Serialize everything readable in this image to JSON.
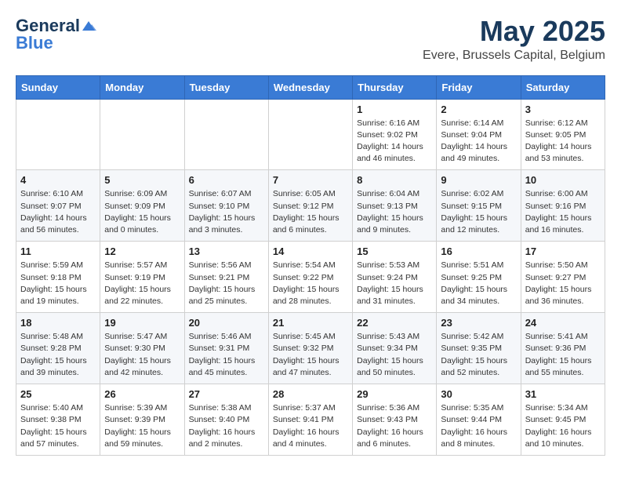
{
  "header": {
    "logo_general": "General",
    "logo_blue": "Blue",
    "month_title": "May 2025",
    "location": "Evere, Brussels Capital, Belgium"
  },
  "weekdays": [
    "Sunday",
    "Monday",
    "Tuesday",
    "Wednesday",
    "Thursday",
    "Friday",
    "Saturday"
  ],
  "weeks": [
    {
      "days": [
        {
          "number": "",
          "info": ""
        },
        {
          "number": "",
          "info": ""
        },
        {
          "number": "",
          "info": ""
        },
        {
          "number": "",
          "info": ""
        },
        {
          "number": "1",
          "info": "Sunrise: 6:16 AM\nSunset: 9:02 PM\nDaylight: 14 hours\nand 46 minutes."
        },
        {
          "number": "2",
          "info": "Sunrise: 6:14 AM\nSunset: 9:04 PM\nDaylight: 14 hours\nand 49 minutes."
        },
        {
          "number": "3",
          "info": "Sunrise: 6:12 AM\nSunset: 9:05 PM\nDaylight: 14 hours\nand 53 minutes."
        }
      ]
    },
    {
      "days": [
        {
          "number": "4",
          "info": "Sunrise: 6:10 AM\nSunset: 9:07 PM\nDaylight: 14 hours\nand 56 minutes."
        },
        {
          "number": "5",
          "info": "Sunrise: 6:09 AM\nSunset: 9:09 PM\nDaylight: 15 hours\nand 0 minutes."
        },
        {
          "number": "6",
          "info": "Sunrise: 6:07 AM\nSunset: 9:10 PM\nDaylight: 15 hours\nand 3 minutes."
        },
        {
          "number": "7",
          "info": "Sunrise: 6:05 AM\nSunset: 9:12 PM\nDaylight: 15 hours\nand 6 minutes."
        },
        {
          "number": "8",
          "info": "Sunrise: 6:04 AM\nSunset: 9:13 PM\nDaylight: 15 hours\nand 9 minutes."
        },
        {
          "number": "9",
          "info": "Sunrise: 6:02 AM\nSunset: 9:15 PM\nDaylight: 15 hours\nand 12 minutes."
        },
        {
          "number": "10",
          "info": "Sunrise: 6:00 AM\nSunset: 9:16 PM\nDaylight: 15 hours\nand 16 minutes."
        }
      ]
    },
    {
      "days": [
        {
          "number": "11",
          "info": "Sunrise: 5:59 AM\nSunset: 9:18 PM\nDaylight: 15 hours\nand 19 minutes."
        },
        {
          "number": "12",
          "info": "Sunrise: 5:57 AM\nSunset: 9:19 PM\nDaylight: 15 hours\nand 22 minutes."
        },
        {
          "number": "13",
          "info": "Sunrise: 5:56 AM\nSunset: 9:21 PM\nDaylight: 15 hours\nand 25 minutes."
        },
        {
          "number": "14",
          "info": "Sunrise: 5:54 AM\nSunset: 9:22 PM\nDaylight: 15 hours\nand 28 minutes."
        },
        {
          "number": "15",
          "info": "Sunrise: 5:53 AM\nSunset: 9:24 PM\nDaylight: 15 hours\nand 31 minutes."
        },
        {
          "number": "16",
          "info": "Sunrise: 5:51 AM\nSunset: 9:25 PM\nDaylight: 15 hours\nand 34 minutes."
        },
        {
          "number": "17",
          "info": "Sunrise: 5:50 AM\nSunset: 9:27 PM\nDaylight: 15 hours\nand 36 minutes."
        }
      ]
    },
    {
      "days": [
        {
          "number": "18",
          "info": "Sunrise: 5:48 AM\nSunset: 9:28 PM\nDaylight: 15 hours\nand 39 minutes."
        },
        {
          "number": "19",
          "info": "Sunrise: 5:47 AM\nSunset: 9:30 PM\nDaylight: 15 hours\nand 42 minutes."
        },
        {
          "number": "20",
          "info": "Sunrise: 5:46 AM\nSunset: 9:31 PM\nDaylight: 15 hours\nand 45 minutes."
        },
        {
          "number": "21",
          "info": "Sunrise: 5:45 AM\nSunset: 9:32 PM\nDaylight: 15 hours\nand 47 minutes."
        },
        {
          "number": "22",
          "info": "Sunrise: 5:43 AM\nSunset: 9:34 PM\nDaylight: 15 hours\nand 50 minutes."
        },
        {
          "number": "23",
          "info": "Sunrise: 5:42 AM\nSunset: 9:35 PM\nDaylight: 15 hours\nand 52 minutes."
        },
        {
          "number": "24",
          "info": "Sunrise: 5:41 AM\nSunset: 9:36 PM\nDaylight: 15 hours\nand 55 minutes."
        }
      ]
    },
    {
      "days": [
        {
          "number": "25",
          "info": "Sunrise: 5:40 AM\nSunset: 9:38 PM\nDaylight: 15 hours\nand 57 minutes."
        },
        {
          "number": "26",
          "info": "Sunrise: 5:39 AM\nSunset: 9:39 PM\nDaylight: 15 hours\nand 59 minutes."
        },
        {
          "number": "27",
          "info": "Sunrise: 5:38 AM\nSunset: 9:40 PM\nDaylight: 16 hours\nand 2 minutes."
        },
        {
          "number": "28",
          "info": "Sunrise: 5:37 AM\nSunset: 9:41 PM\nDaylight: 16 hours\nand 4 minutes."
        },
        {
          "number": "29",
          "info": "Sunrise: 5:36 AM\nSunset: 9:43 PM\nDaylight: 16 hours\nand 6 minutes."
        },
        {
          "number": "30",
          "info": "Sunrise: 5:35 AM\nSunset: 9:44 PM\nDaylight: 16 hours\nand 8 minutes."
        },
        {
          "number": "31",
          "info": "Sunrise: 5:34 AM\nSunset: 9:45 PM\nDaylight: 16 hours\nand 10 minutes."
        }
      ]
    }
  ]
}
